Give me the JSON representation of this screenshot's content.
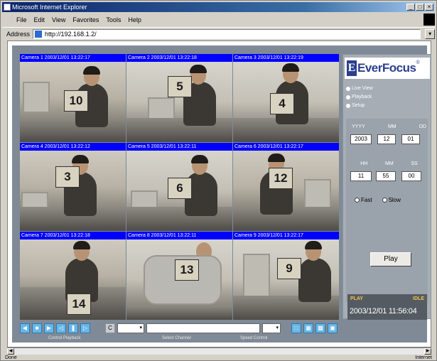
{
  "browser": {
    "title": "Microsoft Internet Explorer",
    "menu": [
      "File",
      "Edit",
      "View",
      "Favorites",
      "Tools",
      "Help"
    ],
    "address_label": "Address",
    "address_value": "http://192.168.1.2/"
  },
  "cameras": [
    {
      "label": "Camera 1 2003/12/01 13:22:17",
      "card": "10"
    },
    {
      "label": "Camera 2 2003/12/01 13:22:18",
      "card": "5"
    },
    {
      "label": "Camera 3 2003/12/01 13:22:19",
      "card": "4"
    },
    {
      "label": "Camera 4 2003/12/01 13:22:12",
      "card": "3"
    },
    {
      "label": "Camera 5 2003/12/01 13:22:11",
      "card": "6"
    },
    {
      "label": "Camera 6 2003/12/01 13:22:17",
      "card": "12"
    },
    {
      "label": "Camera 7 2003/12/01 13:22:18",
      "card": "14"
    },
    {
      "label": "Camera 8 2003/12/01 13:22:11",
      "card": "13"
    },
    {
      "label": "Camera 9 2003/12/01 13:22:17",
      "card": "9"
    }
  ],
  "sidebar": {
    "brand": "EverFocus",
    "options": [
      "Live View",
      "Playback",
      "Setup"
    ],
    "date_labels": [
      "YYYY",
      "MM",
      "DD"
    ],
    "date_values": [
      "2003",
      "12",
      "01"
    ],
    "time_labels": [
      "HH",
      "MM",
      "SS"
    ],
    "time_values": [
      "11",
      "55",
      "00"
    ],
    "radio1": "Fast",
    "radio2": "Slow",
    "play_label": "Play",
    "status_left": "PLAY",
    "status_right": "IDLE",
    "clock": "2003/12/01  11:56:04"
  },
  "controls": {
    "c_label": "C",
    "caption1": "Control Playback",
    "caption2": "Select Channel",
    "caption3": "Speed Control"
  },
  "status": {
    "left": "Done",
    "right": "Internet"
  }
}
